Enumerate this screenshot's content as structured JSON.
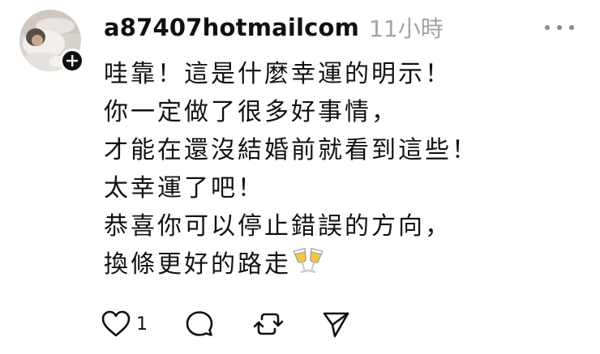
{
  "post": {
    "username": "a87407hotmailcom",
    "timestamp": "11小時",
    "lines": [
      "哇靠！這是什麼幸運的明示！",
      "你一定做了很多好事情，",
      "才能在還沒結婚前就看到這些！",
      "太幸運了吧！",
      "恭喜你可以停止錯誤的方向，",
      "換條更好的路走"
    ],
    "trailing_emoji": "clinking-glasses"
  },
  "actions": {
    "like_count": "1",
    "icons": [
      "heart-icon",
      "comment-icon",
      "repost-icon",
      "share-icon"
    ]
  },
  "colors": {
    "text": "#111111",
    "timestamp": "#a3a3a3",
    "icon": "#111111"
  }
}
